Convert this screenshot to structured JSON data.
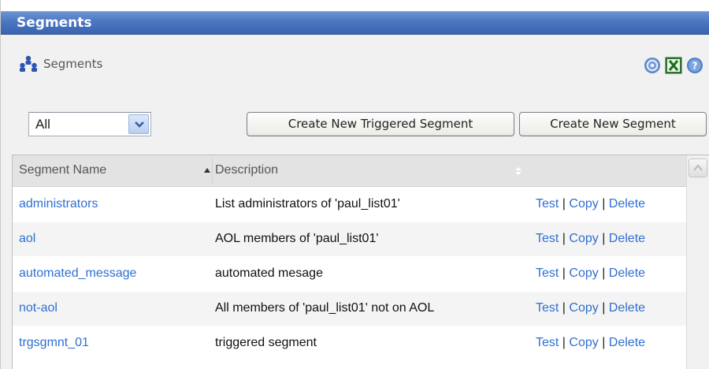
{
  "title_bar": "Segments",
  "header": {
    "label": "Segments",
    "icons": [
      "segments-icon",
      "refresh-icon",
      "excel-export-icon",
      "help-icon"
    ]
  },
  "filter": {
    "selected": "All"
  },
  "buttons": {
    "create_triggered": "Create New Triggered Segment",
    "create_new": "Create New Segment"
  },
  "table": {
    "columns": [
      "Segment Name",
      "Description"
    ],
    "actions": {
      "test": "Test",
      "copy": "Copy",
      "delete": "Delete",
      "sep": " | "
    },
    "rows": [
      {
        "name": "administrators",
        "description": "List administrators of 'paul_list01'"
      },
      {
        "name": "aol",
        "description": "AOL members of 'paul_list01'"
      },
      {
        "name": "automated_message",
        "description": "automated mesage"
      },
      {
        "name": "not-aol",
        "description": "All members of 'paul_list01' not on AOL"
      },
      {
        "name": "trgsgmnt_01",
        "description": "triggered segment"
      }
    ]
  },
  "colors": {
    "title_bar": "#4a76c2",
    "link": "#2f6fd2",
    "header_bg": "#e3e3e3"
  }
}
